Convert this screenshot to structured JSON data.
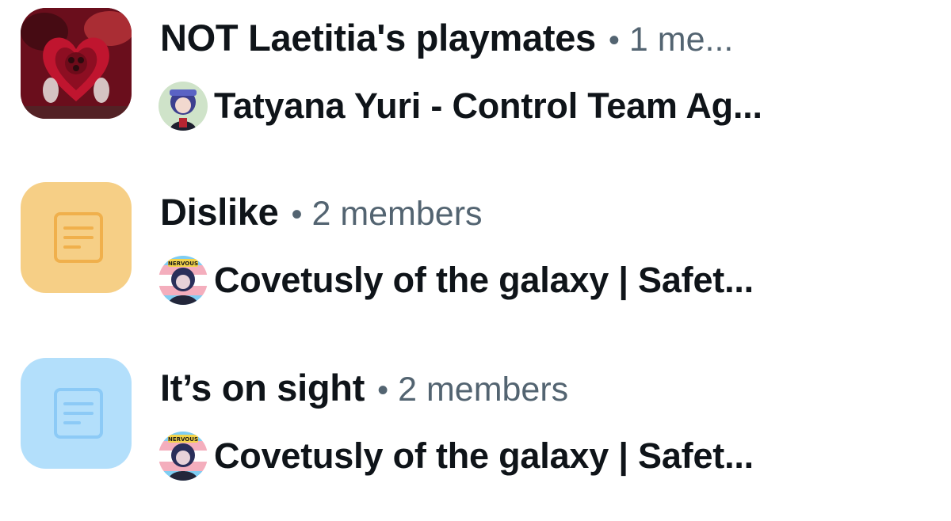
{
  "conversations": [
    {
      "title": "NOT Laetitia's playmates",
      "meta": "1 me...",
      "separator": "•",
      "last_sender": "Tatyana Yuri - Control Team Ag...",
      "thumbnail": {
        "type": "photo",
        "icon": "group-photo-icon"
      },
      "avatar_icon": "tatyana-avatar-icon"
    },
    {
      "title": "Dislike",
      "meta": "2 members",
      "separator": "•",
      "last_sender": "Covetusly of the galaxy | Safet...",
      "thumbnail": {
        "type": "document",
        "icon": "document-icon",
        "bg": "#f6cf86",
        "fg": "#f0b04c"
      },
      "avatar_icon": "covetusly-avatar-icon",
      "avatar_badge": "NERVOUS"
    },
    {
      "title": "It’s on sight",
      "meta": "2 members",
      "separator": "•",
      "last_sender": "Covetusly of the galaxy | Safet...",
      "thumbnail": {
        "type": "document",
        "icon": "document-icon",
        "bg": "#b3dffb",
        "fg": "#8ccaf6"
      },
      "avatar_icon": "covetusly-avatar-icon",
      "avatar_badge": "NERVOUS"
    }
  ]
}
